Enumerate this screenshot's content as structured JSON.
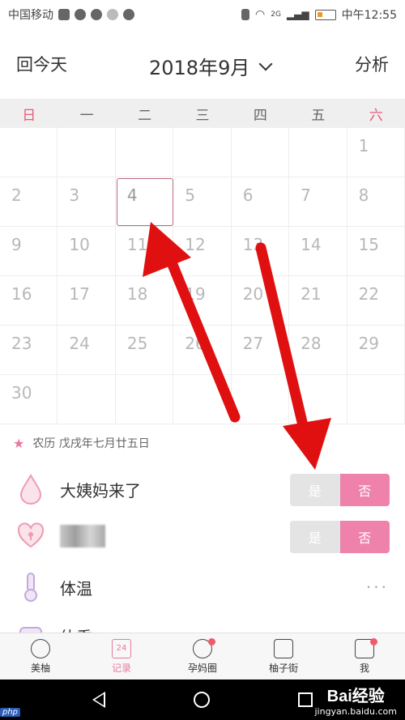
{
  "status_bar": {
    "carrier": "中国移动",
    "time": "中午12:55",
    "network": "2G"
  },
  "header": {
    "today_button": "回今天",
    "month_title": "2018年9月",
    "analyze_button": "分析"
  },
  "weekdays": [
    "日",
    "一",
    "二",
    "三",
    "四",
    "五",
    "六"
  ],
  "calendar": {
    "days": [
      "",
      "",
      "",
      "",
      "",
      "",
      "1",
      "2",
      "3",
      "4",
      "5",
      "6",
      "7",
      "8",
      "9",
      "10",
      "11",
      "12",
      "13",
      "14",
      "15",
      "16",
      "17",
      "18",
      "19",
      "20",
      "21",
      "22",
      "23",
      "24",
      "25",
      "26",
      "27",
      "28",
      "29",
      "30",
      "",
      "",
      "",
      "",
      "",
      ""
    ],
    "selected_day": "4"
  },
  "lunar": {
    "text": "农历 戊戌年七月廿五日"
  },
  "records": {
    "period": {
      "label": "大姨妈来了",
      "yes": "是",
      "no": "否"
    },
    "love": {
      "yes": "是",
      "no": "否"
    },
    "temperature": {
      "label": "体温",
      "more": "···"
    },
    "weight": {
      "label": "体重"
    }
  },
  "tabbar": {
    "tabs": [
      {
        "label": "美柚",
        "icon": "bowl-icon"
      },
      {
        "label": "记录",
        "icon": "calendar-icon",
        "icon_text": "24"
      },
      {
        "label": "孕妈圈",
        "icon": "lollipop-icon"
      },
      {
        "label": "柚子街",
        "icon": "shopping-bag-icon"
      },
      {
        "label": "我",
        "icon": "user-icon"
      }
    ]
  },
  "watermarks": {
    "php": "php",
    "baidu_logo": "Bai经验",
    "baidu_url": "jingyan.baidu.com"
  },
  "colors": {
    "accent_pink": "#ef82ab",
    "arrow_red": "#e01010",
    "weekend_red": "#e85a78"
  }
}
